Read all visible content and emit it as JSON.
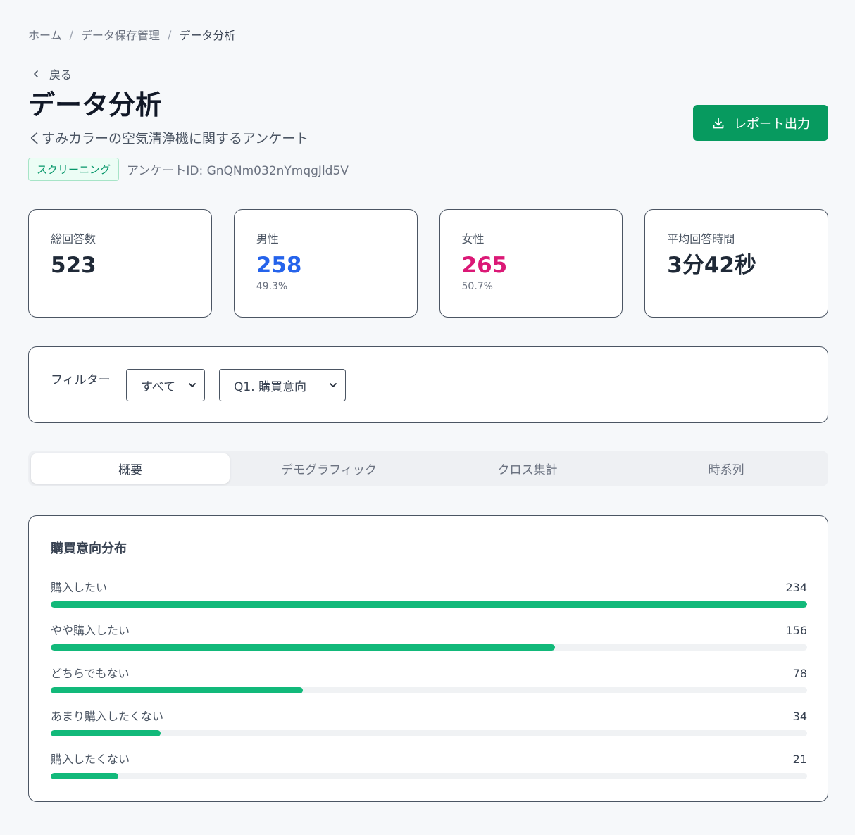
{
  "breadcrumb": {
    "items": [
      "ホーム",
      "データ保存管理",
      "データ分析"
    ],
    "separator": "/"
  },
  "back": {
    "label": "戻る"
  },
  "header": {
    "title": "データ分析",
    "subtitle": "くすみカラーの空気清浄機に関するアンケート",
    "tag": "スクリーニング",
    "survey_id": "アンケートID: GnQNm032nYmqgJld5V",
    "export_label": "レポート出力"
  },
  "stats": [
    {
      "label": "総回答数",
      "value": "523",
      "pct": ""
    },
    {
      "label": "男性",
      "value": "258",
      "pct": "49.3%"
    },
    {
      "label": "女性",
      "value": "265",
      "pct": "50.7%"
    },
    {
      "label": "平均回答時間",
      "value": "3分42秒",
      "pct": ""
    }
  ],
  "filter": {
    "label": "フィルター",
    "segment": "すべて",
    "question": "Q1. 購買意向"
  },
  "tabs": [
    "概要",
    "デモグラフィック",
    "クロス集計",
    "時系列"
  ],
  "colors": {
    "accent": "#079a5f",
    "bar": "#12b97a",
    "male": "#2563eb",
    "female": "#db1876"
  },
  "chart_data": {
    "type": "bar",
    "title": "購買意向分布",
    "categories": [
      "購入したい",
      "やや購入したい",
      "どちらでもない",
      "あまり購入したくない",
      "購入したくない"
    ],
    "values": [
      234,
      156,
      78,
      34,
      21
    ],
    "max": 234
  }
}
